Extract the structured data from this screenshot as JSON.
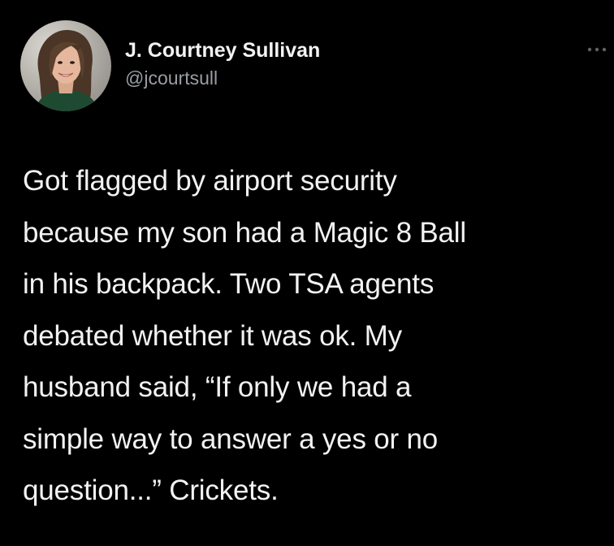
{
  "theme": {
    "background": "#000000",
    "text_primary": "#f2f2f2",
    "text_secondary": "#9a9ea3"
  },
  "author": {
    "display_name": "J. Courtney Sullivan",
    "handle": "@jcourtsull",
    "avatar_icon": "profile-photo"
  },
  "menu": {
    "icon": "more-dots-icon"
  },
  "tweet": {
    "text": "Got flagged by airport security\nbecause my son had a Magic 8 Ball\nin his backpack. Two TSA agents\ndebated whether it was ok. My\nhusband said, “If only we had a\nsimple way to answer a yes or no\nquestion...” Crickets."
  }
}
